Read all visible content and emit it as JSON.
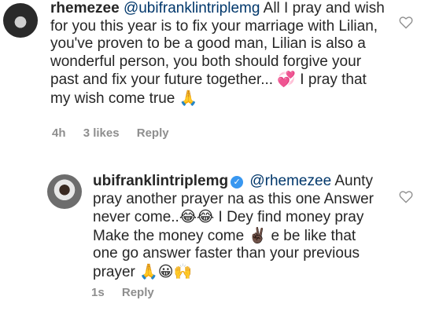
{
  "comments": [
    {
      "username": "rhemezee",
      "mention": "@ubifranklintriplemg",
      "text_1": "All I pray and wish for you this year is to fix your marriage with Lilian, you've proven to be a good man, Lilian is also a wonderful person, you both should forgive your past and fix your future together...",
      "emoji_1": "💞",
      "text_2": "I pray that my wish come true",
      "emoji_2": "🙏",
      "time": "4h",
      "likes": "3 likes",
      "reply_label": "Reply"
    },
    {
      "username": "ubifranklintriplemg",
      "verified_icon": "✓",
      "mention": "@rhemezee",
      "text_1": "Aunty pray another prayer na as this one Answer never come..",
      "emoji_1": "😂😂",
      "text_2": "I Dey find money pray Make the money come",
      "emoji_2": "✌🏿",
      "text_3": "e be like that one go answer faster than your previous prayer",
      "emoji_3": "🙏😀🙌",
      "time": "1s",
      "reply_label": "Reply"
    }
  ],
  "colors": {
    "text": "#262626",
    "mention": "#00376b",
    "meta": "#8e8e8e",
    "verified": "#3897f0"
  }
}
